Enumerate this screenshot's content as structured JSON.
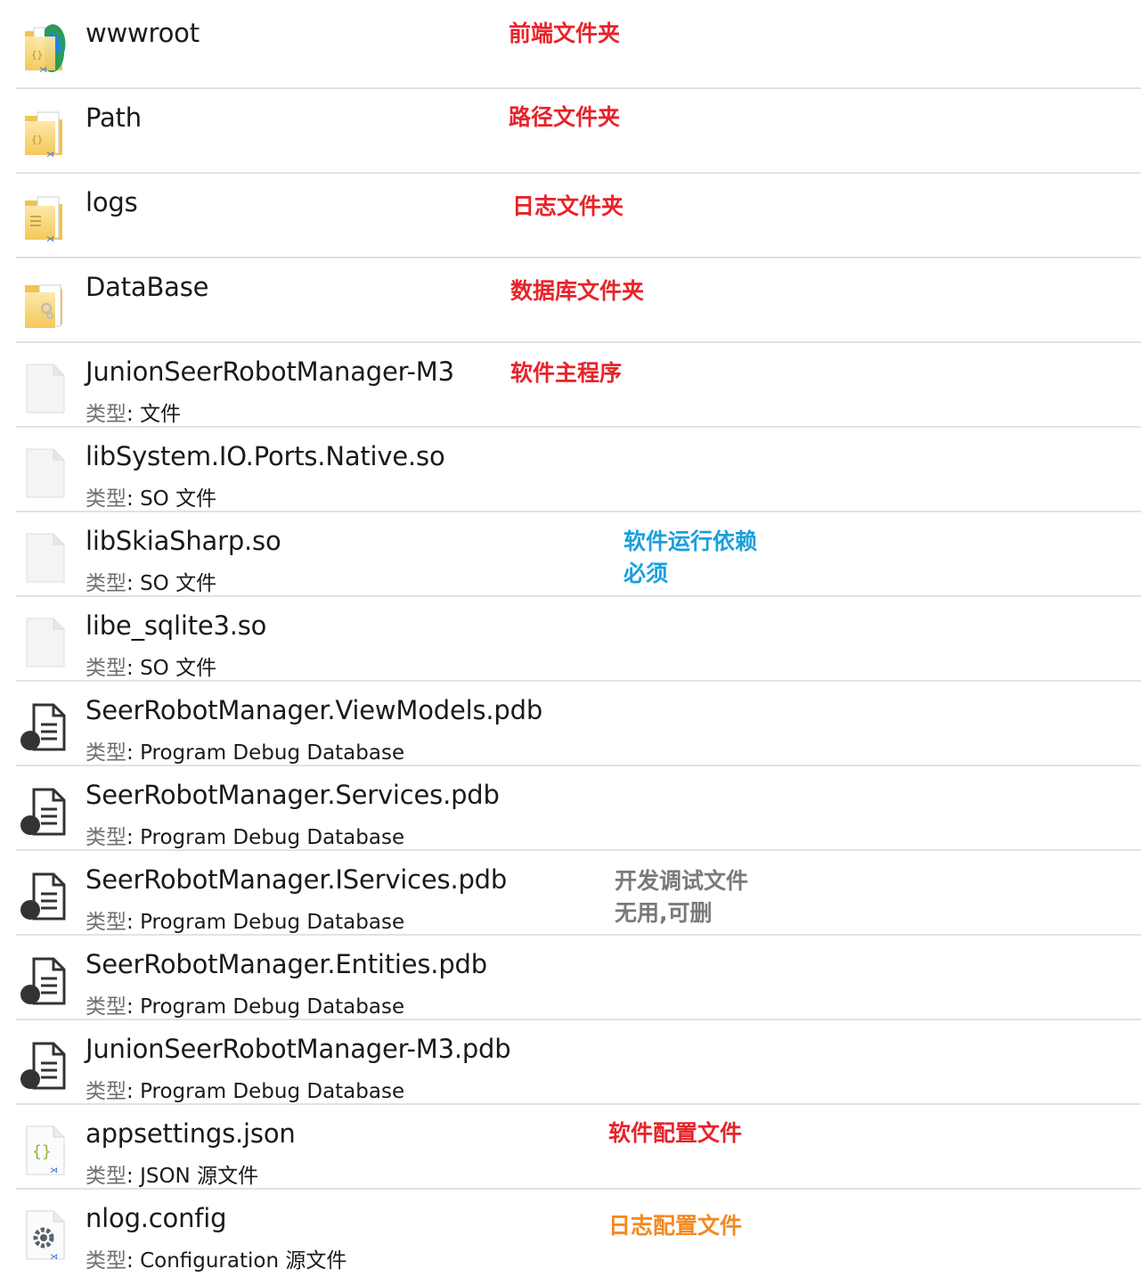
{
  "type_label": "类型",
  "items": [
    {
      "name": "wwwroot",
      "type": "",
      "icon": "folder-code-icon"
    },
    {
      "name": "Path",
      "type": "",
      "icon": "folder-code-icon"
    },
    {
      "name": "logs",
      "type": "",
      "icon": "folder-text-icon"
    },
    {
      "name": "DataBase",
      "type": "",
      "icon": "folder-gear-icon"
    },
    {
      "name": "JunionSeerRobotManager-M3",
      "type": "文件",
      "icon": "blank-file-icon"
    },
    {
      "name": "libSystem.IO.Ports.Native.so",
      "type": "SO 文件",
      "icon": "blank-file-icon"
    },
    {
      "name": "libSkiaSharp.so",
      "type": "SO 文件",
      "icon": "blank-file-icon"
    },
    {
      "name": "libe_sqlite3.so",
      "type": "SO 文件",
      "icon": "blank-file-icon"
    },
    {
      "name": "SeerRobotManager.ViewModels.pdb",
      "type": "Program Debug Database",
      "icon": "pdb-file-icon"
    },
    {
      "name": "SeerRobotManager.Services.pdb",
      "type": "Program Debug Database",
      "icon": "pdb-file-icon"
    },
    {
      "name": "SeerRobotManager.IServices.pdb",
      "type": "Program Debug Database",
      "icon": "pdb-file-icon"
    },
    {
      "name": "SeerRobotManager.Entities.pdb",
      "type": "Program Debug Database",
      "icon": "pdb-file-icon"
    },
    {
      "name": "JunionSeerRobotManager-M3.pdb",
      "type": "Program Debug Database",
      "icon": "pdb-file-icon"
    },
    {
      "name": "appsettings.json",
      "type": "JSON 源文件",
      "icon": "json-file-icon"
    },
    {
      "name": "nlog.config",
      "type": "Configuration 源文件",
      "icon": "config-file-icon"
    }
  ],
  "annotations": {
    "wwwroot": "前端文件夹",
    "path": "路径文件夹",
    "logs": "日志文件夹",
    "database": "数据库文件夹",
    "main_program": "软件主程序",
    "runtime_line1": "软件运行依赖",
    "runtime_line2": "必须",
    "debug_line1": "开发调试文件",
    "debug_line2": "无用,可删",
    "app_config": "软件配置文件",
    "log_config": "日志配置文件"
  },
  "colors": {
    "annotation_red": "#e8232a",
    "annotation_blue": "#1aa0dd",
    "annotation_gray": "#7a7a7a",
    "annotation_orange": "#f28a22"
  }
}
